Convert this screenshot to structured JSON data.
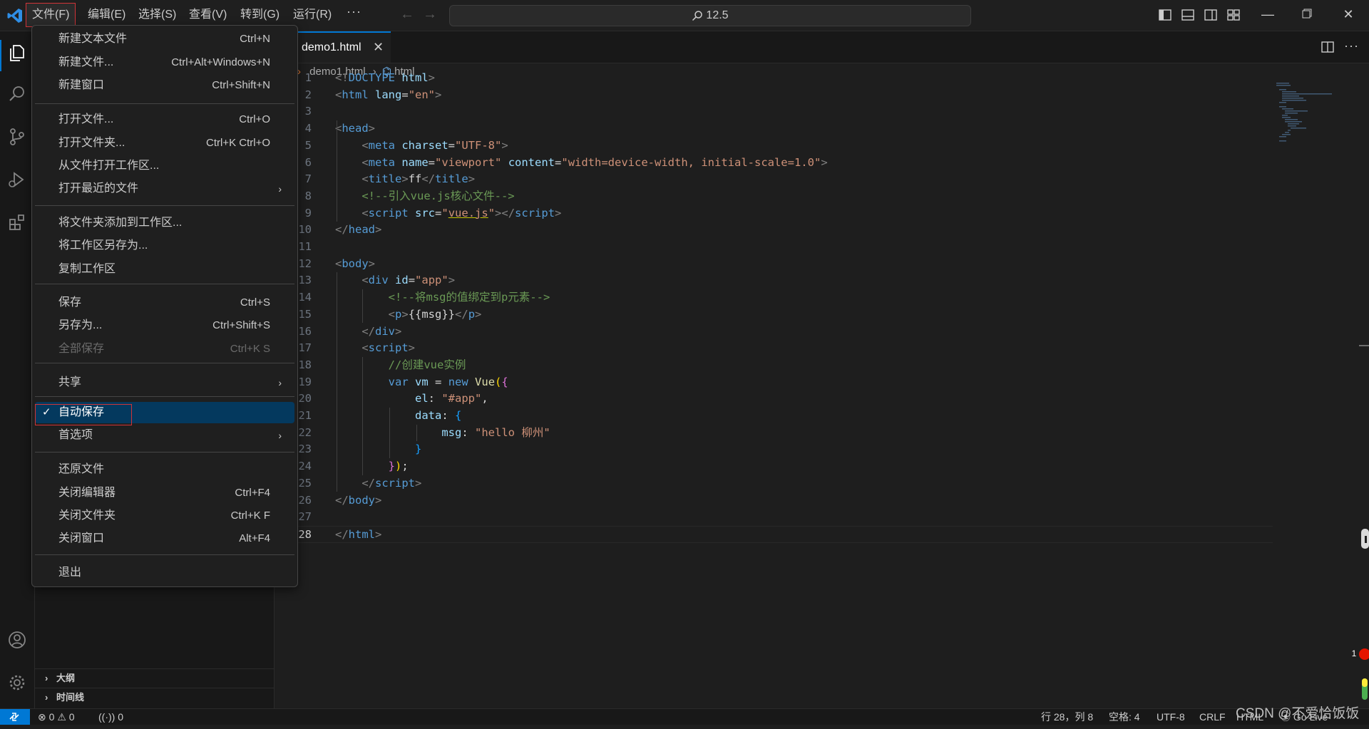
{
  "menubar": {
    "items": [
      {
        "label": "文件(F)"
      },
      {
        "label": "编辑(E)"
      },
      {
        "label": "选择(S)"
      },
      {
        "label": "查看(V)"
      },
      {
        "label": "转到(G)"
      },
      {
        "label": "运行(R)"
      }
    ],
    "more": "···"
  },
  "command_center": {
    "text": "12.5"
  },
  "tab": {
    "label": "demo1.html",
    "close": "✕"
  },
  "more_actions": "···",
  "breadcrumb": {
    "file": "demo1.html",
    "symbol": "html"
  },
  "code": {
    "line_numbers": [
      "1",
      "2",
      "3",
      "4",
      "5",
      "6",
      "7",
      "8",
      "9",
      "10",
      "11",
      "12",
      "13",
      "14",
      "15",
      "16",
      "17",
      "18",
      "19",
      "20",
      "21",
      "22",
      "23",
      "24",
      "25",
      "26",
      "27",
      "28"
    ],
    "current_line": 28
  },
  "file_menu": {
    "items": [
      {
        "label": "新建文本文件",
        "shortcut": "Ctrl+N"
      },
      {
        "label": "新建文件...",
        "shortcut": "Ctrl+Alt+Windows+N"
      },
      {
        "label": "新建窗口",
        "shortcut": "Ctrl+Shift+N"
      },
      {
        "label": "打开文件...",
        "shortcut": "Ctrl+O"
      },
      {
        "label": "打开文件夹...",
        "shortcut": "Ctrl+K Ctrl+O"
      },
      {
        "label": "从文件打开工作区...",
        "shortcut": ""
      },
      {
        "label": "打开最近的文件",
        "shortcut": "",
        "submenu": "›"
      },
      {
        "label": "将文件夹添加到工作区...",
        "shortcut": ""
      },
      {
        "label": "将工作区另存为...",
        "shortcut": ""
      },
      {
        "label": "复制工作区",
        "shortcut": ""
      },
      {
        "label": "保存",
        "shortcut": "Ctrl+S"
      },
      {
        "label": "另存为...",
        "shortcut": "Ctrl+Shift+S"
      },
      {
        "label": "全部保存",
        "shortcut": "Ctrl+K S",
        "disabled": true
      },
      {
        "label": "共享",
        "shortcut": "",
        "submenu": "›"
      },
      {
        "label": "自动保存",
        "shortcut": "",
        "checked": "✓"
      },
      {
        "label": "首选项",
        "shortcut": "",
        "submenu": "›"
      },
      {
        "label": "还原文件",
        "shortcut": ""
      },
      {
        "label": "关闭编辑器",
        "shortcut": "Ctrl+F4"
      },
      {
        "label": "关闭文件夹",
        "shortcut": "Ctrl+K F"
      },
      {
        "label": "关闭窗口",
        "shortcut": "Alt+F4"
      },
      {
        "label": "退出",
        "shortcut": ""
      }
    ]
  },
  "sidebar": {
    "sections": [
      {
        "label": "大纲",
        "chevron": "›"
      },
      {
        "label": "时间线",
        "chevron": "›"
      }
    ]
  },
  "statusbar": {
    "errors": "0",
    "warnings": "0",
    "ports": "0",
    "cursor": "行 28，列 8",
    "spaces": "空格: 4",
    "encoding": "UTF-8",
    "eol": "CRLF",
    "language": "HTML",
    "golive": "Go Live",
    "watermark": "CSDN @不爱恰饭饭"
  },
  "notification_badge": "1",
  "colors": {
    "accent": "#0078d4",
    "highlight_border": "#d13438",
    "menu_selected": "#04395e"
  }
}
